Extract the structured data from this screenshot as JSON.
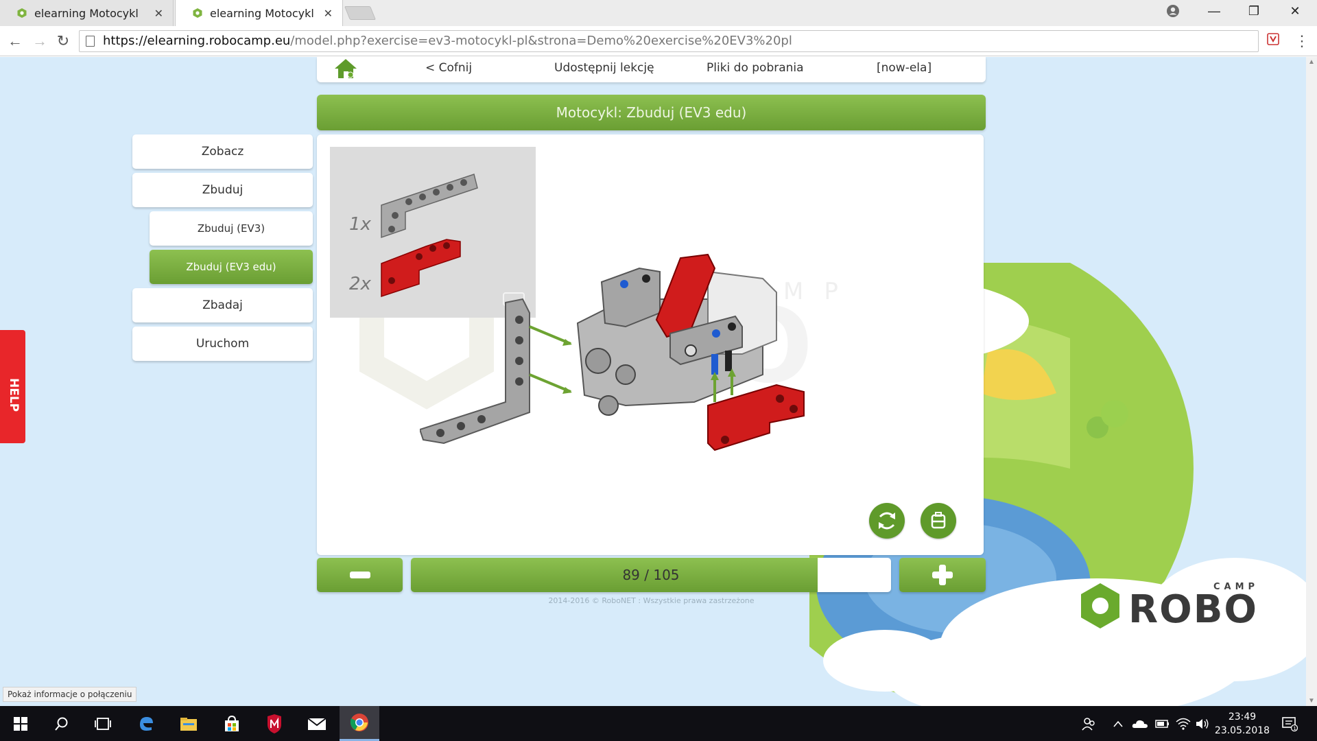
{
  "browser": {
    "tabs": [
      {
        "title": "elearning Motocykl",
        "active": false
      },
      {
        "title": "elearning Motocykl",
        "active": true
      }
    ],
    "url_host": "https://elearning.robocamp.eu",
    "url_path": "/model.php?exercise=ev3-motocykl-pl&strona=Demo%20exercise%20EV3%20pl"
  },
  "topnav": {
    "back": "< Cofnij",
    "share": "Udostępnij lekcję",
    "downloads": "Pliki do pobrania",
    "user": "[now-ela]"
  },
  "title": "Motocykl: Zbuduj (EV3 edu)",
  "sidemenu": [
    {
      "label": "Zobacz"
    },
    {
      "label": "Zbuduj"
    },
    {
      "label": "Zbuduj (EV3)"
    },
    {
      "label": "Zbuduj (EV3 edu)"
    },
    {
      "label": "Zbadaj"
    },
    {
      "label": "Uruchom"
    }
  ],
  "parts": [
    {
      "qty": "1x",
      "color": "#a9a9a9"
    },
    {
      "qty": "2x",
      "color": "#d01c1c"
    }
  ],
  "step": {
    "current": 89,
    "total": 105,
    "label": "89 / 105"
  },
  "copyright": "2014-2016 © RoboNET : Wszystkie prawa zastrzeżone",
  "help": "HELP",
  "status_bubble": "Pokaż informacje o połączeniu",
  "logo": {
    "small": "CAMP",
    "big": "ROBO"
  },
  "clock": {
    "time": "23:49",
    "date": "23.05.2018"
  },
  "colors": {
    "accent": "#78ad3e",
    "help": "#e8262a",
    "page_bg": "#d7ebfa"
  }
}
